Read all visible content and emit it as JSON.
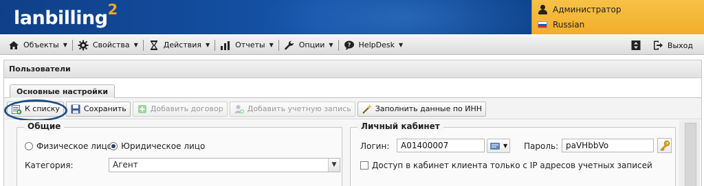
{
  "app": {
    "logo_text": "lanbilling",
    "logo_sup": "2"
  },
  "user_box": {
    "user_name": "Администратор",
    "language": "Russian"
  },
  "menu": {
    "items": [
      {
        "label": "Объекты",
        "icon": "house-icon"
      },
      {
        "label": "Свойства",
        "icon": "gear-icon"
      },
      {
        "label": "Действия",
        "icon": "hourglass-icon"
      },
      {
        "label": "Отчеты",
        "icon": "bar-chart-icon"
      },
      {
        "label": "Опции",
        "icon": "wrench-icon"
      },
      {
        "label": "HelpDesk",
        "icon": "chat-bubble-icon"
      }
    ],
    "logout_label": "Выход"
  },
  "panel": {
    "title": "Пользователи",
    "tab_label": "Основные настройки"
  },
  "toolbar": {
    "back_label": "К списку",
    "save_label": "Сохранить",
    "add_contract_label": "Добавить договор",
    "add_account_label": "Добавить учетную запись",
    "fill_inn_label": "Заполнить данные по ИНН"
  },
  "common": {
    "legend": "Общие",
    "radio_physical": "Физическое лицо",
    "radio_legal": "Юридическое лицо",
    "selected_type": "Юридическое лицо",
    "category_label": "Категория:",
    "category_value": "Агент"
  },
  "cabinet": {
    "legend": "Личный кабинет",
    "login_label": "Логин:",
    "login_value": "A01400007",
    "password_label": "Пароль:",
    "password_value": "paVHbbVo",
    "ip_restrict_label": "Доступ в кабинет клиента только с IP адресов учетных записей",
    "ip_restrict_checked": false
  },
  "colors": {
    "banner_blue": "#1553a8",
    "user_box_orange": "#f2ad2a",
    "logo_accent": "#f0a81a",
    "highlight_ring": "#1b4f86"
  }
}
